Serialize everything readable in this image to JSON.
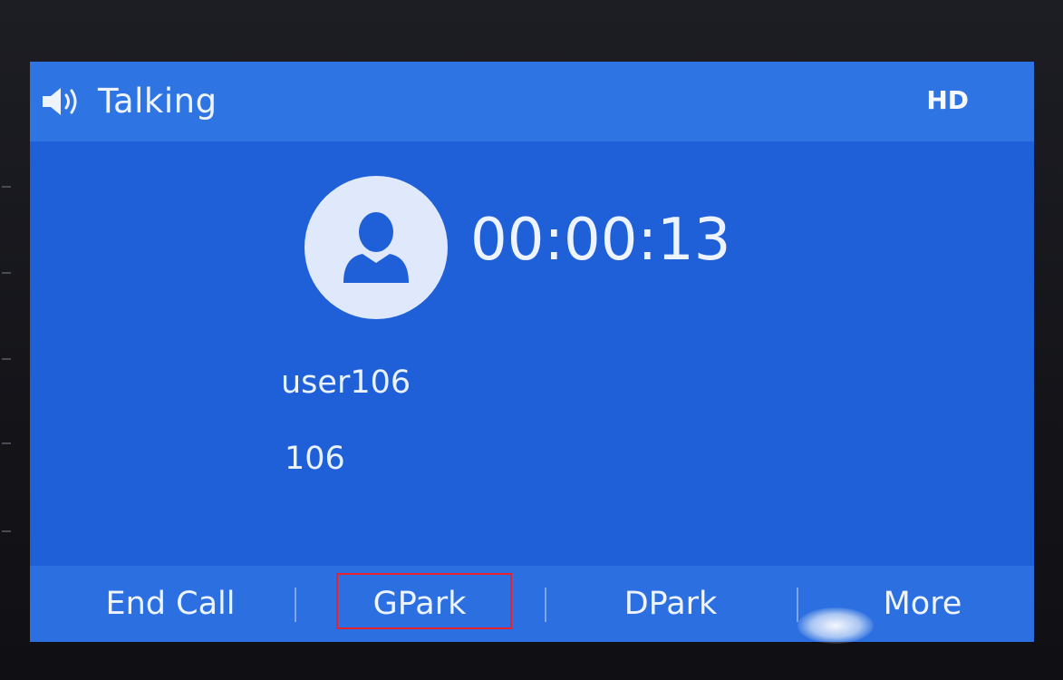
{
  "status": {
    "state_label": "Talking",
    "audio_badge": "HD",
    "speaker_icon": "speaker-icon"
  },
  "call": {
    "duration": "00:00:13",
    "caller_name": "user106",
    "caller_number": "106",
    "avatar_icon": "user-avatar-icon"
  },
  "softkeys": [
    {
      "label": "End Call"
    },
    {
      "label": "GPark"
    },
    {
      "label": "DPark"
    },
    {
      "label": "More"
    }
  ],
  "colors": {
    "screen_background": "#1e5fd8",
    "status_bar": "#2f74e3",
    "softkey_bar": "#2b6fe0",
    "highlight_border": "#e8222a",
    "text": "#eef4ff"
  }
}
